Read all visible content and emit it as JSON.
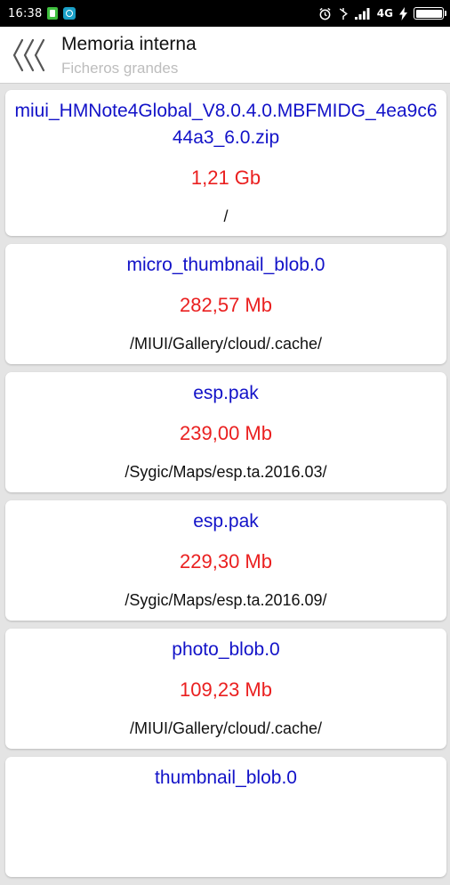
{
  "status_bar": {
    "time": "16:38",
    "network": "4G"
  },
  "header": {
    "title": "Memoria interna",
    "subtitle": "Ficheros grandes"
  },
  "files": [
    {
      "name": "miui_HMNote4Global_V8.0.4.0.MBFMIDG_4ea9c644a3_6.0.zip",
      "size": "1,21 Gb",
      "path": "/"
    },
    {
      "name": "micro_thumbnail_blob.0",
      "size": "282,57 Mb",
      "path": "/MIUI/Gallery/cloud/.cache/"
    },
    {
      "name": "esp.pak",
      "size": "239,00 Mb",
      "path": "/Sygic/Maps/esp.ta.2016.03/"
    },
    {
      "name": "esp.pak",
      "size": "229,30 Mb",
      "path": "/Sygic/Maps/esp.ta.2016.09/"
    },
    {
      "name": "photo_blob.0",
      "size": "109,23 Mb",
      "path": "/MIUI/Gallery/cloud/.cache/"
    },
    {
      "name": "thumbnail_blob.0",
      "size": "",
      "path": ""
    }
  ],
  "colors": {
    "file_name": "#1212c8",
    "file_size": "#ea2020",
    "file_path": "#111111",
    "subtitle": "#bdbdbd",
    "background": "#e4e4e4"
  }
}
